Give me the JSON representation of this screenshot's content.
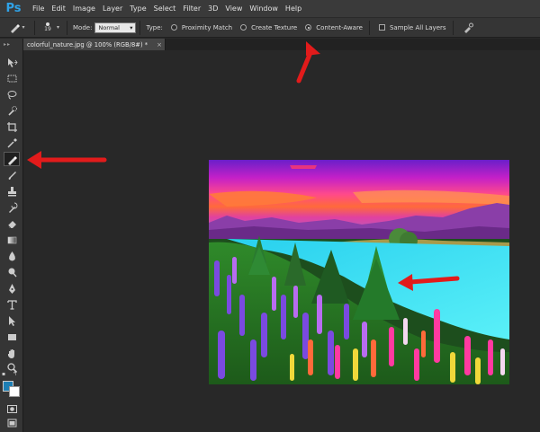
{
  "app": {
    "logo": "Ps",
    "menu": [
      "File",
      "Edit",
      "Image",
      "Layer",
      "Type",
      "Select",
      "Filter",
      "3D",
      "View",
      "Window",
      "Help"
    ]
  },
  "options": {
    "brush_size": "19",
    "mode_label": "Mode:",
    "mode_value": "Normal",
    "type_label": "Type:",
    "type_options": [
      {
        "label": "Proximity Match",
        "checked": false
      },
      {
        "label": "Create Texture",
        "checked": false
      },
      {
        "label": "Content-Aware",
        "checked": true
      }
    ],
    "sample_all_layers_label": "Sample All Layers",
    "sample_all_layers_checked": false
  },
  "document": {
    "tab_title": "colorful_nature.jpg @ 100% (RGB/8#) *",
    "close_glyph": "×"
  },
  "colors": {
    "foreground": "#1d7fb5",
    "background": "#ffffff",
    "annotation_arrow": "#e21b1b",
    "brand": "#2fa3e8"
  },
  "tools": [
    "move-icon",
    "marquee-icon",
    "lasso-icon",
    "quick-selection-icon",
    "crop-icon",
    "eyedropper-icon",
    "spot-healing-brush-icon",
    "brush-icon",
    "clone-stamp-icon",
    "history-brush-icon",
    "eraser-icon",
    "gradient-icon",
    "blur-icon",
    "dodge-icon",
    "pen-icon",
    "type-icon",
    "path-selection-icon",
    "rectangle-icon",
    "hand-icon",
    "zoom-icon"
  ],
  "active_tool": "spot-healing-brush-icon"
}
